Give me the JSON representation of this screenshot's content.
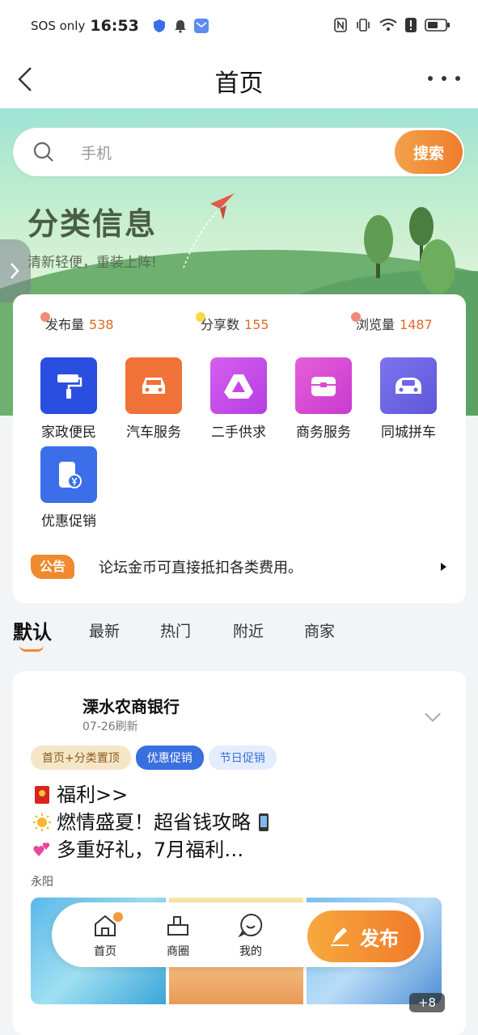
{
  "status_bar": {
    "sos": "SOS only",
    "time": "16:53"
  },
  "nav": {
    "title": "首页"
  },
  "search": {
    "placeholder": "手机",
    "button": "搜索"
  },
  "hero": {
    "title": "分类信息",
    "subtitle": "清新轻便，重装上阵!"
  },
  "stats": [
    {
      "label": "发布量",
      "value": "538",
      "dot_color": "#f08a7a"
    },
    {
      "label": "分享数",
      "value": "155",
      "dot_color": "#f7d94a"
    },
    {
      "label": "浏览量",
      "value": "1487",
      "dot_color": "#f08a7a"
    }
  ],
  "categories": [
    {
      "label": "家政便民",
      "icon": "paint-roller-icon",
      "color": "#2a4ee0"
    },
    {
      "label": "汽车服务",
      "icon": "car-icon",
      "color": "#f07238"
    },
    {
      "label": "二手供求",
      "icon": "triangle-drive-icon",
      "color": "#c846e8"
    },
    {
      "label": "商务服务",
      "icon": "briefcase-icon",
      "color": "#d94cd6"
    },
    {
      "label": "同城拼车",
      "icon": "car-front-icon",
      "color": "#6f67e6"
    },
    {
      "label": "优惠促销",
      "icon": "phone-yen-icon",
      "color": "#3b6ee8"
    }
  ],
  "notice": {
    "tag": "公告",
    "text": "论坛金币可直接抵扣各类费用。"
  },
  "tabs": [
    "默认",
    "最新",
    "热门",
    "附近",
    "商家"
  ],
  "post": {
    "name": "溧水农商银行",
    "date": "07-26刷新",
    "tags": [
      "首页+分类置顶",
      "优惠促销",
      "节日促销"
    ],
    "lines": [
      "福利>>",
      "燃情盛夏！超省钱攻略",
      "多重好礼，7月福利…"
    ],
    "location": "永阳",
    "more_images": "+8"
  },
  "bottom_bar": {
    "home": "首页",
    "circle": "商圈",
    "mine": "我的",
    "publish": "发布"
  }
}
